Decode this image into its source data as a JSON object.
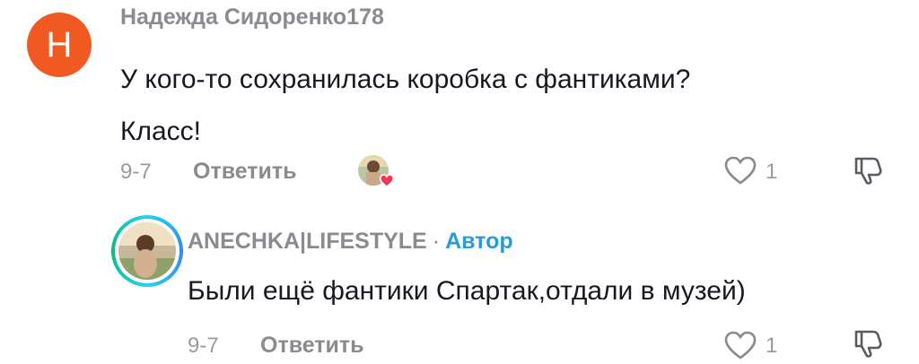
{
  "comment": {
    "avatar_initial": "Н",
    "author": "Надежда Сидоренко178",
    "text_line1": "У кого-то сохранилась коробка с фантиками?",
    "text_line2": "Класс!",
    "date": "9-7",
    "reply_label": "Ответить",
    "like_count": "1",
    "liked_by_creator_icon": "creator-avatar-with-heart"
  },
  "reply": {
    "author": "ANECHKA|LIFESTYLE",
    "separator": "·",
    "badge": "Автор",
    "text": "Были ещё фантики Спартак,отдали в музей)",
    "date": "9-7",
    "reply_label": "Ответить",
    "like_count": "1"
  },
  "colors": {
    "initial_avatar_bg": "#f05a22",
    "author_badge": "#2a9bd8",
    "like_heart": "#f0365b"
  }
}
